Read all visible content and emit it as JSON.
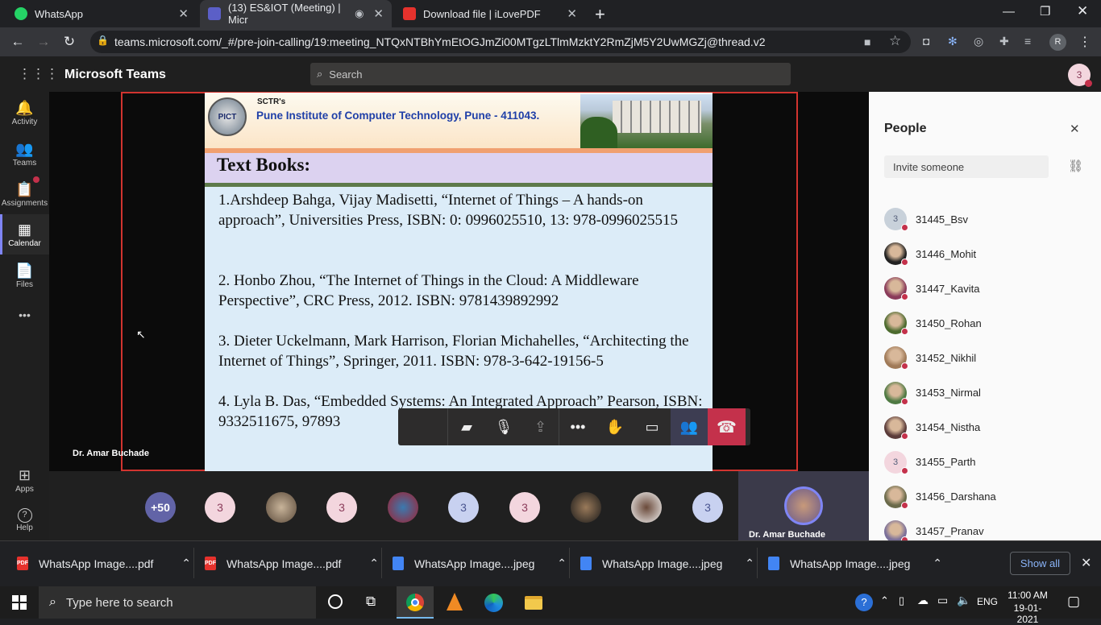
{
  "browser": {
    "tabs": [
      {
        "title": "WhatsApp",
        "active": false
      },
      {
        "title": "(13) ES&IOT (Meeting) | Micr",
        "active": true
      },
      {
        "title": "Download file | iLovePDF",
        "active": false
      }
    ],
    "new_tab": "+",
    "url": "teams.microsoft.com/_#/pre-join-calling/19:meeting_NTQxNTBhYmEtOGJmZi00MTgzLTlmMzktY2RmZjM5Y2UwMGZj@thread.v2",
    "profile_initial": "R"
  },
  "teams": {
    "app_title": "Microsoft Teams",
    "search_placeholder": "Search",
    "user_avatar": "3",
    "rail": [
      {
        "label": "Activity",
        "icon": "bell-icon",
        "glyph": "🔔"
      },
      {
        "label": "Teams",
        "icon": "teams-icon",
        "glyph": "👥"
      },
      {
        "label": "Assignments",
        "icon": "assignments-icon",
        "glyph": "📋"
      },
      {
        "label": "Calendar",
        "icon": "calendar-icon",
        "glyph": "▦"
      },
      {
        "label": "Files",
        "icon": "files-icon",
        "glyph": "📄"
      },
      {
        "label": "Apps",
        "icon": "apps-icon",
        "glyph": "⊞"
      },
      {
        "label": "Help",
        "icon": "help-icon",
        "glyph": "?"
      }
    ],
    "rail_more": "•••",
    "presenter_name": "Dr. Amar Buchade",
    "slide": {
      "org_small": "SCTR's",
      "org_name": "Pune Institute of Computer Technology, Pune - 411043.",
      "logo_text": "PICT",
      "heading": "Text Books:",
      "books": [
        "1.Arshdeep Bahga, Vijay Madisetti, “Internet of Things – A hands-on approach”, Universities Press, ISBN: 0: 0996025510, 13: 978-0996025515",
        "2. Honbo Zhou, “The Internet of Things in the Cloud: A Middleware Perspective”, CRC Press, 2012. ISBN: 9781439892992",
        "3. Dieter Uckelmann, Mark Harrison, Florian Michahelles, “Architecting the Internet of Things”, Springer, 2011. ISBN: 978-3-642-19156-5",
        "4. Lyla B. Das, “Embedded Systems: An Integrated Approach” Pearson, ISBN: 9332511675, 97893"
      ]
    },
    "participants_strip": {
      "overflow_count": "+50",
      "avatars": [
        "3",
        "",
        "3",
        "",
        "3",
        "3",
        "",
        "",
        "3"
      ],
      "speaker_name": "Dr. Amar Buchade"
    },
    "people_panel": {
      "title": "People",
      "invite_placeholder": "Invite someone",
      "people": [
        {
          "name": "31445_Bsv",
          "avatar": "3",
          "photo": false,
          "color": "#c8d1da"
        },
        {
          "name": "31446_Mohit",
          "avatar": "",
          "photo": true,
          "color": "#222222"
        },
        {
          "name": "31447_Kavita",
          "avatar": "",
          "photo": true,
          "color": "#8a3b5a"
        },
        {
          "name": "31450_Rohan",
          "avatar": "",
          "photo": true,
          "color": "#4d6b2f"
        },
        {
          "name": "31452_Nikhil",
          "avatar": "",
          "photo": true,
          "color": "#a07a58"
        },
        {
          "name": "31453_Nirmal",
          "avatar": "",
          "photo": true,
          "color": "#4f7a43"
        },
        {
          "name": "31454_Nistha",
          "avatar": "",
          "photo": true,
          "color": "#5b3c3a"
        },
        {
          "name": "31455_Parth",
          "avatar": "3",
          "photo": false,
          "color": "#f3d6de"
        },
        {
          "name": "31456_Darshana",
          "avatar": "",
          "photo": true,
          "color": "#6a6a4a"
        },
        {
          "name": "31457_Pranav",
          "avatar": "",
          "photo": true,
          "color": "#7a6f9a"
        }
      ]
    }
  },
  "downloads": {
    "items": [
      {
        "name": "WhatsApp Image....pdf",
        "type": "pdf"
      },
      {
        "name": "WhatsApp Image....pdf",
        "type": "pdf"
      },
      {
        "name": "WhatsApp Image....jpeg",
        "type": "jpeg"
      },
      {
        "name": "WhatsApp Image....jpeg",
        "type": "jpeg"
      },
      {
        "name": "WhatsApp Image....jpeg",
        "type": "jpeg"
      }
    ],
    "show_all": "Show all"
  },
  "taskbar": {
    "search_placeholder": "Type here to search",
    "language": "ENG",
    "time": "11:00 AM",
    "date": "19-01-2021"
  }
}
